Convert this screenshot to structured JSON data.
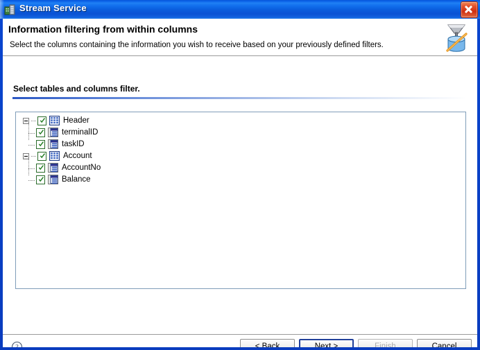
{
  "window": {
    "title": "Stream Service",
    "app_icon": "server-building-icon",
    "close_label": "Close",
    "accent_color": "#0a4ad2",
    "titlebar_text_color": "#ffffff"
  },
  "header": {
    "title": "Information filtering from within columns",
    "description": "Select the columns containing the information you wish to receive based on your previously defined filters.",
    "icon": "funnel-database-filter-icon"
  },
  "section": {
    "label": "Select tables and columns filter.",
    "rule_color": "#2b57c4"
  },
  "tree": {
    "check_color": "#1f7a1f",
    "nodes": [
      {
        "label": "Header",
        "type": "table",
        "icon": "table-grid-icon",
        "expanded": true,
        "checked": true,
        "children": [
          {
            "label": "terminalID",
            "type": "column",
            "icon": "column-list-icon",
            "checked": true
          },
          {
            "label": "taskID",
            "type": "column",
            "icon": "column-list-icon",
            "checked": true
          }
        ]
      },
      {
        "label": "Account",
        "type": "table",
        "icon": "table-grid-icon",
        "expanded": true,
        "checked": true,
        "children": [
          {
            "label": "AccountNo",
            "type": "column",
            "icon": "column-list-icon",
            "checked": true
          },
          {
            "label": "Balance",
            "type": "column",
            "icon": "column-list-icon",
            "checked": true
          }
        ]
      }
    ]
  },
  "footer": {
    "help_icon": "help-question-icon",
    "buttons": [
      {
        "label": "< Back",
        "name": "back-button",
        "state": "enabled"
      },
      {
        "label": "Next >",
        "name": "next-button",
        "state": "focused"
      },
      {
        "label": "Finish",
        "name": "finish-button",
        "state": "disabled"
      },
      {
        "label": "Cancel",
        "name": "cancel-button",
        "state": "enabled"
      }
    ]
  }
}
